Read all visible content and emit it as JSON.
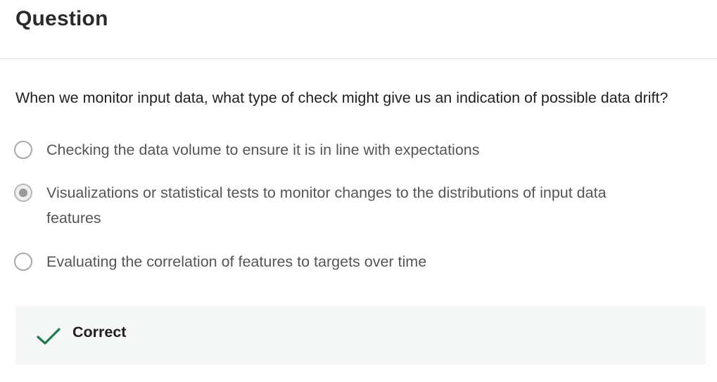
{
  "header": {
    "title": "Question"
  },
  "question": {
    "text": "When we monitor input data, what type of check might give us an indication of possible data drift?"
  },
  "options": [
    {
      "label": "Checking the data volume to ensure it is in line with expectations",
      "selected": false
    },
    {
      "label": "Visualizations or statistical tests to monitor changes to the distributions of input data features",
      "selected": true
    },
    {
      "label": "Evaluating the correlation of features to targets over time",
      "selected": false
    }
  ],
  "feedback": {
    "label": "Correct",
    "icon": "checkmark-icon",
    "color": "#1f7a4d"
  }
}
